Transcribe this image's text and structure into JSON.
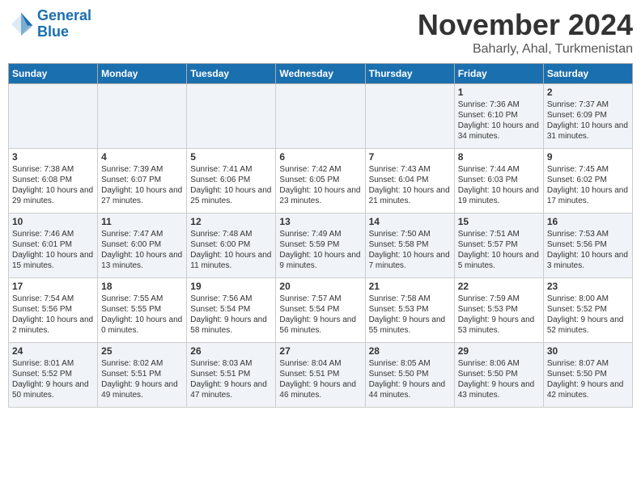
{
  "header": {
    "logo_line1": "General",
    "logo_line2": "Blue",
    "month": "November 2024",
    "location": "Baharly, Ahal, Turkmenistan"
  },
  "days_of_week": [
    "Sunday",
    "Monday",
    "Tuesday",
    "Wednesday",
    "Thursday",
    "Friday",
    "Saturday"
  ],
  "weeks": [
    [
      {
        "day": "",
        "info": ""
      },
      {
        "day": "",
        "info": ""
      },
      {
        "day": "",
        "info": ""
      },
      {
        "day": "",
        "info": ""
      },
      {
        "day": "",
        "info": ""
      },
      {
        "day": "1",
        "info": "Sunrise: 7:36 AM\nSunset: 6:10 PM\nDaylight: 10 hours and 34 minutes."
      },
      {
        "day": "2",
        "info": "Sunrise: 7:37 AM\nSunset: 6:09 PM\nDaylight: 10 hours and 31 minutes."
      }
    ],
    [
      {
        "day": "3",
        "info": "Sunrise: 7:38 AM\nSunset: 6:08 PM\nDaylight: 10 hours and 29 minutes."
      },
      {
        "day": "4",
        "info": "Sunrise: 7:39 AM\nSunset: 6:07 PM\nDaylight: 10 hours and 27 minutes."
      },
      {
        "day": "5",
        "info": "Sunrise: 7:41 AM\nSunset: 6:06 PM\nDaylight: 10 hours and 25 minutes."
      },
      {
        "day": "6",
        "info": "Sunrise: 7:42 AM\nSunset: 6:05 PM\nDaylight: 10 hours and 23 minutes."
      },
      {
        "day": "7",
        "info": "Sunrise: 7:43 AM\nSunset: 6:04 PM\nDaylight: 10 hours and 21 minutes."
      },
      {
        "day": "8",
        "info": "Sunrise: 7:44 AM\nSunset: 6:03 PM\nDaylight: 10 hours and 19 minutes."
      },
      {
        "day": "9",
        "info": "Sunrise: 7:45 AM\nSunset: 6:02 PM\nDaylight: 10 hours and 17 minutes."
      }
    ],
    [
      {
        "day": "10",
        "info": "Sunrise: 7:46 AM\nSunset: 6:01 PM\nDaylight: 10 hours and 15 minutes."
      },
      {
        "day": "11",
        "info": "Sunrise: 7:47 AM\nSunset: 6:00 PM\nDaylight: 10 hours and 13 minutes."
      },
      {
        "day": "12",
        "info": "Sunrise: 7:48 AM\nSunset: 6:00 PM\nDaylight: 10 hours and 11 minutes."
      },
      {
        "day": "13",
        "info": "Sunrise: 7:49 AM\nSunset: 5:59 PM\nDaylight: 10 hours and 9 minutes."
      },
      {
        "day": "14",
        "info": "Sunrise: 7:50 AM\nSunset: 5:58 PM\nDaylight: 10 hours and 7 minutes."
      },
      {
        "day": "15",
        "info": "Sunrise: 7:51 AM\nSunset: 5:57 PM\nDaylight: 10 hours and 5 minutes."
      },
      {
        "day": "16",
        "info": "Sunrise: 7:53 AM\nSunset: 5:56 PM\nDaylight: 10 hours and 3 minutes."
      }
    ],
    [
      {
        "day": "17",
        "info": "Sunrise: 7:54 AM\nSunset: 5:56 PM\nDaylight: 10 hours and 2 minutes."
      },
      {
        "day": "18",
        "info": "Sunrise: 7:55 AM\nSunset: 5:55 PM\nDaylight: 10 hours and 0 minutes."
      },
      {
        "day": "19",
        "info": "Sunrise: 7:56 AM\nSunset: 5:54 PM\nDaylight: 9 hours and 58 minutes."
      },
      {
        "day": "20",
        "info": "Sunrise: 7:57 AM\nSunset: 5:54 PM\nDaylight: 9 hours and 56 minutes."
      },
      {
        "day": "21",
        "info": "Sunrise: 7:58 AM\nSunset: 5:53 PM\nDaylight: 9 hours and 55 minutes."
      },
      {
        "day": "22",
        "info": "Sunrise: 7:59 AM\nSunset: 5:53 PM\nDaylight: 9 hours and 53 minutes."
      },
      {
        "day": "23",
        "info": "Sunrise: 8:00 AM\nSunset: 5:52 PM\nDaylight: 9 hours and 52 minutes."
      }
    ],
    [
      {
        "day": "24",
        "info": "Sunrise: 8:01 AM\nSunset: 5:52 PM\nDaylight: 9 hours and 50 minutes."
      },
      {
        "day": "25",
        "info": "Sunrise: 8:02 AM\nSunset: 5:51 PM\nDaylight: 9 hours and 49 minutes."
      },
      {
        "day": "26",
        "info": "Sunrise: 8:03 AM\nSunset: 5:51 PM\nDaylight: 9 hours and 47 minutes."
      },
      {
        "day": "27",
        "info": "Sunrise: 8:04 AM\nSunset: 5:51 PM\nDaylight: 9 hours and 46 minutes."
      },
      {
        "day": "28",
        "info": "Sunrise: 8:05 AM\nSunset: 5:50 PM\nDaylight: 9 hours and 44 minutes."
      },
      {
        "day": "29",
        "info": "Sunrise: 8:06 AM\nSunset: 5:50 PM\nDaylight: 9 hours and 43 minutes."
      },
      {
        "day": "30",
        "info": "Sunrise: 8:07 AM\nSunset: 5:50 PM\nDaylight: 9 hours and 42 minutes."
      }
    ]
  ]
}
